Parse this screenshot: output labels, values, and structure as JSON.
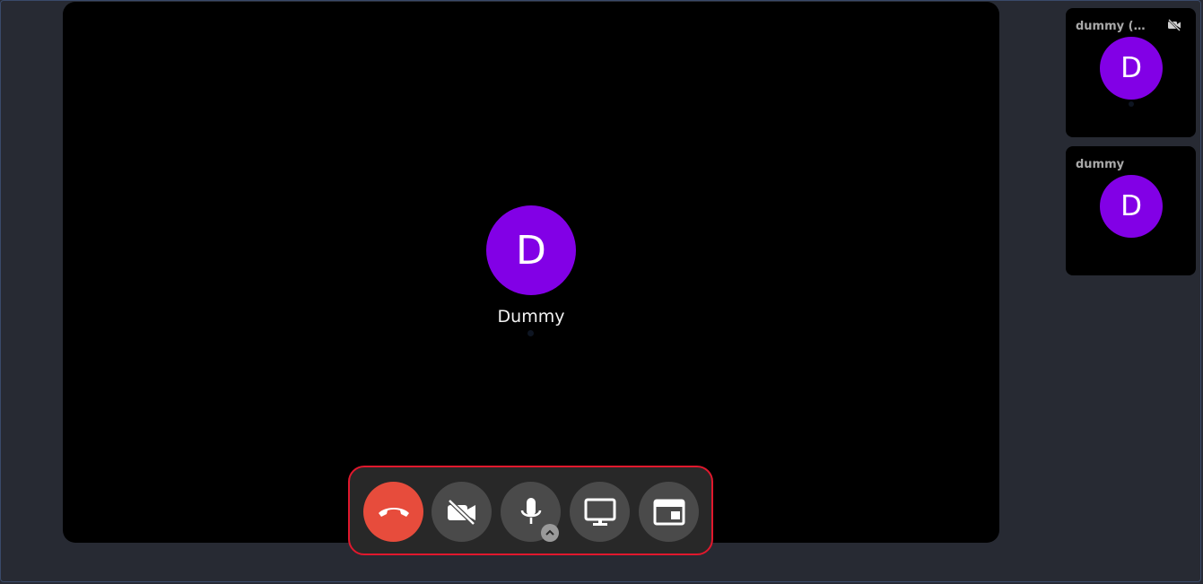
{
  "main_participant": {
    "initial": "D",
    "name": "Dummy",
    "avatar_color": "#8200e6"
  },
  "sidebar": {
    "tiles": [
      {
        "name": "dummy (y…",
        "initial": "D",
        "camera_off_icon": "camera-off-icon"
      },
      {
        "name": "dummy",
        "initial": "D"
      }
    ]
  },
  "controls": {
    "hangup_color": "#e74c3c",
    "buttons": [
      {
        "icon": "hang-up-icon"
      },
      {
        "icon": "camera-off-icon"
      },
      {
        "icon": "microphone-icon"
      },
      {
        "icon": "screen-share-icon"
      },
      {
        "icon": "layout-icon"
      }
    ],
    "highlight_color": "#e0182d"
  }
}
